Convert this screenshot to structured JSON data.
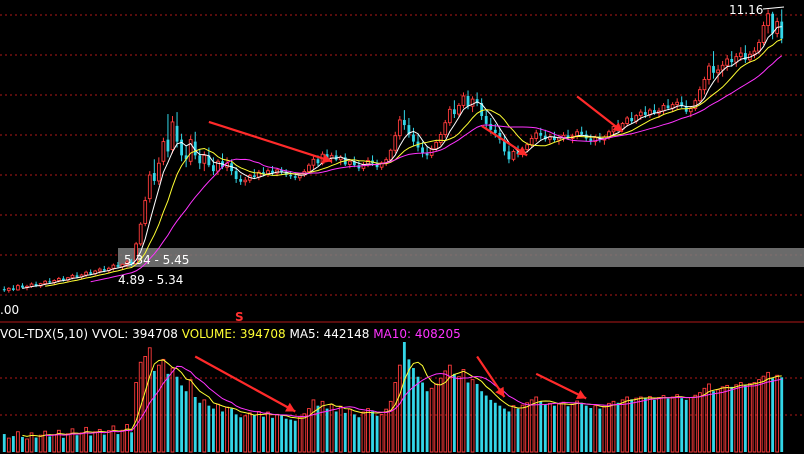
{
  "colors": {
    "background": "#000000",
    "up": "#ff3c3c",
    "down": "#33d6e8",
    "ma5": "#ffffff",
    "ma10": "#ffff33",
    "ma20": "#ff33ff",
    "vol_ma5": "#ffff33",
    "vol_ma10": "#ff33ff",
    "grid": "#b01818",
    "band": "#7d7d7d",
    "arrow": "#ff2a2a"
  },
  "chart_data": {
    "type": "candlestick",
    "price_max_label": "11.16",
    "price_min_label": ".00",
    "band_label": "5.34 - 5.45",
    "range_label": "4.89 - 5.34",
    "signal_marker": "S",
    "candles": [
      {
        "o": 4.05,
        "h": 4.12,
        "l": 3.98,
        "c": 4.02
      },
      {
        "o": 4.02,
        "h": 4.1,
        "l": 3.96,
        "c": 4.07
      },
      {
        "o": 4.07,
        "h": 4.15,
        "l": 4.0,
        "c": 4.03
      },
      {
        "o": 4.03,
        "h": 4.18,
        "l": 4.01,
        "c": 4.14
      },
      {
        "o": 4.14,
        "h": 4.2,
        "l": 4.06,
        "c": 4.09
      },
      {
        "o": 4.09,
        "h": 4.16,
        "l": 4.02,
        "c": 4.12
      },
      {
        "o": 4.12,
        "h": 4.22,
        "l": 4.08,
        "c": 4.18
      },
      {
        "o": 4.18,
        "h": 4.24,
        "l": 4.1,
        "c": 4.13
      },
      {
        "o": 4.13,
        "h": 4.21,
        "l": 4.08,
        "c": 4.19
      },
      {
        "o": 4.19,
        "h": 4.28,
        "l": 4.15,
        "c": 4.25
      },
      {
        "o": 4.25,
        "h": 4.33,
        "l": 4.18,
        "c": 4.22
      },
      {
        "o": 4.22,
        "h": 4.3,
        "l": 4.16,
        "c": 4.27
      },
      {
        "o": 4.27,
        "h": 4.36,
        "l": 4.22,
        "c": 4.32
      },
      {
        "o": 4.32,
        "h": 4.38,
        "l": 4.24,
        "c": 4.28
      },
      {
        "o": 4.28,
        "h": 4.36,
        "l": 4.22,
        "c": 4.34
      },
      {
        "o": 4.34,
        "h": 4.44,
        "l": 4.3,
        "c": 4.4
      },
      {
        "o": 4.4,
        "h": 4.48,
        "l": 4.32,
        "c": 4.36
      },
      {
        "o": 4.36,
        "h": 4.44,
        "l": 4.3,
        "c": 4.41
      },
      {
        "o": 4.41,
        "h": 4.52,
        "l": 4.36,
        "c": 4.48
      },
      {
        "o": 4.48,
        "h": 4.55,
        "l": 4.4,
        "c": 4.44
      },
      {
        "o": 4.44,
        "h": 4.54,
        "l": 4.4,
        "c": 4.51
      },
      {
        "o": 4.51,
        "h": 4.6,
        "l": 4.45,
        "c": 4.56
      },
      {
        "o": 4.56,
        "h": 4.64,
        "l": 4.48,
        "c": 4.52
      },
      {
        "o": 4.52,
        "h": 4.62,
        "l": 4.47,
        "c": 4.58
      },
      {
        "o": 4.58,
        "h": 4.7,
        "l": 4.52,
        "c": 4.66
      },
      {
        "o": 4.66,
        "h": 4.74,
        "l": 4.58,
        "c": 4.62
      },
      {
        "o": 4.62,
        "h": 4.7,
        "l": 4.55,
        "c": 4.68
      },
      {
        "o": 4.68,
        "h": 4.8,
        "l": 4.6,
        "c": 4.74
      },
      {
        "o": 4.74,
        "h": 4.82,
        "l": 4.64,
        "c": 4.69
      },
      {
        "o": 4.7,
        "h": 5.25,
        "l": 4.68,
        "c": 5.2
      },
      {
        "o": 5.2,
        "h": 5.75,
        "l": 5.15,
        "c": 5.7
      },
      {
        "o": 5.72,
        "h": 6.4,
        "l": 5.65,
        "c": 6.3
      },
      {
        "o": 6.35,
        "h": 7.05,
        "l": 6.25,
        "c": 6.95
      },
      {
        "o": 7.0,
        "h": 7.35,
        "l": 6.7,
        "c": 6.8
      },
      {
        "o": 6.8,
        "h": 7.4,
        "l": 6.7,
        "c": 7.25
      },
      {
        "o": 7.3,
        "h": 7.9,
        "l": 7.2,
        "c": 7.8
      },
      {
        "o": 7.85,
        "h": 8.5,
        "l": 7.4,
        "c": 7.55
      },
      {
        "o": 7.6,
        "h": 8.45,
        "l": 7.5,
        "c": 8.3
      },
      {
        "o": 8.2,
        "h": 8.55,
        "l": 7.65,
        "c": 7.8
      },
      {
        "o": 7.85,
        "h": 8.0,
        "l": 7.3,
        "c": 7.45
      },
      {
        "o": 7.45,
        "h": 7.7,
        "l": 7.15,
        "c": 7.35
      },
      {
        "o": 7.3,
        "h": 7.95,
        "l": 7.2,
        "c": 7.85
      },
      {
        "o": 7.8,
        "h": 8.05,
        "l": 7.35,
        "c": 7.45
      },
      {
        "o": 7.45,
        "h": 7.6,
        "l": 7.1,
        "c": 7.25
      },
      {
        "o": 7.25,
        "h": 7.55,
        "l": 7.05,
        "c": 7.45
      },
      {
        "o": 7.45,
        "h": 7.65,
        "l": 7.15,
        "c": 7.2
      },
      {
        "o": 7.2,
        "h": 7.4,
        "l": 6.95,
        "c": 7.05
      },
      {
        "o": 7.05,
        "h": 7.35,
        "l": 6.95,
        "c": 7.3
      },
      {
        "o": 7.3,
        "h": 7.5,
        "l": 7.1,
        "c": 7.15
      },
      {
        "o": 7.15,
        "h": 7.4,
        "l": 7.05,
        "c": 7.25
      },
      {
        "o": 7.25,
        "h": 7.35,
        "l": 6.95,
        "c": 7.05
      },
      {
        "o": 7.05,
        "h": 7.15,
        "l": 6.75,
        "c": 6.85
      },
      {
        "o": 6.85,
        "h": 6.95,
        "l": 6.7,
        "c": 6.78
      },
      {
        "o": 6.78,
        "h": 6.9,
        "l": 6.68,
        "c": 6.82
      },
      {
        "o": 6.82,
        "h": 6.98,
        "l": 6.75,
        "c": 6.94
      },
      {
        "o": 6.94,
        "h": 7.1,
        "l": 6.85,
        "c": 6.9
      },
      {
        "o": 6.9,
        "h": 7.08,
        "l": 6.82,
        "c": 7.02
      },
      {
        "o": 7.02,
        "h": 7.15,
        "l": 6.92,
        "c": 6.98
      },
      {
        "o": 6.98,
        "h": 7.12,
        "l": 6.9,
        "c": 7.06
      },
      {
        "o": 7.06,
        "h": 7.18,
        "l": 6.95,
        "c": 7.0
      },
      {
        "o": 7.0,
        "h": 7.12,
        "l": 6.92,
        "c": 7.08
      },
      {
        "o": 7.08,
        "h": 7.15,
        "l": 6.96,
        "c": 7.02
      },
      {
        "o": 7.02,
        "h": 7.1,
        "l": 6.9,
        "c": 6.95
      },
      {
        "o": 6.95,
        "h": 7.05,
        "l": 6.85,
        "c": 6.92
      },
      {
        "o": 6.92,
        "h": 7.02,
        "l": 6.82,
        "c": 6.88
      },
      {
        "o": 6.88,
        "h": 7.0,
        "l": 6.8,
        "c": 6.96
      },
      {
        "o": 6.96,
        "h": 7.1,
        "l": 6.9,
        "c": 7.04
      },
      {
        "o": 7.04,
        "h": 7.25,
        "l": 7.0,
        "c": 7.2
      },
      {
        "o": 7.2,
        "h": 7.42,
        "l": 7.1,
        "c": 7.35
      },
      {
        "o": 7.35,
        "h": 7.45,
        "l": 7.18,
        "c": 7.25
      },
      {
        "o": 7.25,
        "h": 7.55,
        "l": 7.2,
        "c": 7.48
      },
      {
        "o": 7.48,
        "h": 7.6,
        "l": 7.3,
        "c": 7.38
      },
      {
        "o": 7.38,
        "h": 7.52,
        "l": 7.25,
        "c": 7.45
      },
      {
        "o": 7.45,
        "h": 7.58,
        "l": 7.3,
        "c": 7.34
      },
      {
        "o": 7.34,
        "h": 7.46,
        "l": 7.2,
        "c": 7.4
      },
      {
        "o": 7.4,
        "h": 7.5,
        "l": 7.18,
        "c": 7.22
      },
      {
        "o": 7.22,
        "h": 7.36,
        "l": 7.12,
        "c": 7.3
      },
      {
        "o": 7.3,
        "h": 7.42,
        "l": 7.15,
        "c": 7.2
      },
      {
        "o": 7.2,
        "h": 7.3,
        "l": 7.05,
        "c": 7.12
      },
      {
        "o": 7.12,
        "h": 7.28,
        "l": 7.05,
        "c": 7.22
      },
      {
        "o": 7.22,
        "h": 7.4,
        "l": 7.15,
        "c": 7.32
      },
      {
        "o": 7.32,
        "h": 7.45,
        "l": 7.18,
        "c": 7.25
      },
      {
        "o": 7.25,
        "h": 7.34,
        "l": 7.08,
        "c": 7.15
      },
      {
        "o": 7.15,
        "h": 7.3,
        "l": 7.08,
        "c": 7.26
      },
      {
        "o": 7.26,
        "h": 7.4,
        "l": 7.18,
        "c": 7.34
      },
      {
        "o": 7.34,
        "h": 7.62,
        "l": 7.3,
        "c": 7.58
      },
      {
        "o": 7.58,
        "h": 8.05,
        "l": 7.5,
        "c": 7.95
      },
      {
        "o": 7.95,
        "h": 8.45,
        "l": 7.85,
        "c": 8.35
      },
      {
        "o": 8.35,
        "h": 8.6,
        "l": 8.1,
        "c": 8.22
      },
      {
        "o": 8.22,
        "h": 8.4,
        "l": 7.9,
        "c": 7.98
      },
      {
        "o": 7.98,
        "h": 8.15,
        "l": 7.7,
        "c": 7.8
      },
      {
        "o": 7.8,
        "h": 8.0,
        "l": 7.55,
        "c": 7.65
      },
      {
        "o": 7.65,
        "h": 7.8,
        "l": 7.4,
        "c": 7.5
      },
      {
        "o": 7.5,
        "h": 7.66,
        "l": 7.35,
        "c": 7.45
      },
      {
        "o": 7.45,
        "h": 7.7,
        "l": 7.38,
        "c": 7.62
      },
      {
        "o": 7.62,
        "h": 7.85,
        "l": 7.55,
        "c": 7.78
      },
      {
        "o": 7.78,
        "h": 8.05,
        "l": 7.7,
        "c": 7.98
      },
      {
        "o": 7.98,
        "h": 8.35,
        "l": 7.9,
        "c": 8.28
      },
      {
        "o": 8.28,
        "h": 8.7,
        "l": 8.2,
        "c": 8.62
      },
      {
        "o": 8.62,
        "h": 8.85,
        "l": 8.4,
        "c": 8.5
      },
      {
        "o": 8.5,
        "h": 8.78,
        "l": 8.42,
        "c": 8.72
      },
      {
        "o": 8.72,
        "h": 9.05,
        "l": 8.65,
        "c": 8.96
      },
      {
        "o": 8.96,
        "h": 9.1,
        "l": 8.62,
        "c": 8.7
      },
      {
        "o": 8.7,
        "h": 8.95,
        "l": 8.55,
        "c": 8.88
      },
      {
        "o": 8.88,
        "h": 9.05,
        "l": 8.7,
        "c": 8.78
      },
      {
        "o": 8.78,
        "h": 8.9,
        "l": 8.35,
        "c": 8.45
      },
      {
        "o": 8.45,
        "h": 8.6,
        "l": 8.15,
        "c": 8.25
      },
      {
        "o": 8.25,
        "h": 8.4,
        "l": 8.0,
        "c": 8.1
      },
      {
        "o": 8.1,
        "h": 8.25,
        "l": 7.9,
        "c": 8.02
      },
      {
        "o": 8.02,
        "h": 8.15,
        "l": 7.75,
        "c": 7.85
      },
      {
        "o": 7.85,
        "h": 7.98,
        "l": 7.45,
        "c": 7.55
      },
      {
        "o": 7.55,
        "h": 7.7,
        "l": 7.25,
        "c": 7.35
      },
      {
        "o": 7.35,
        "h": 7.6,
        "l": 7.3,
        "c": 7.55
      },
      {
        "o": 7.55,
        "h": 7.7,
        "l": 7.4,
        "c": 7.48
      },
      {
        "o": 7.48,
        "h": 7.66,
        "l": 7.4,
        "c": 7.6
      },
      {
        "o": 7.6,
        "h": 7.78,
        "l": 7.52,
        "c": 7.72
      },
      {
        "o": 7.72,
        "h": 7.95,
        "l": 7.65,
        "c": 7.88
      },
      {
        "o": 7.88,
        "h": 8.1,
        "l": 7.8,
        "c": 8.02
      },
      {
        "o": 8.02,
        "h": 8.15,
        "l": 7.85,
        "c": 7.95
      },
      {
        "o": 7.95,
        "h": 8.1,
        "l": 7.8,
        "c": 7.86
      },
      {
        "o": 7.86,
        "h": 8.0,
        "l": 7.75,
        "c": 7.92
      },
      {
        "o": 7.92,
        "h": 8.05,
        "l": 7.78,
        "c": 7.84
      },
      {
        "o": 7.84,
        "h": 7.98,
        "l": 7.72,
        "c": 7.9
      },
      {
        "o": 7.9,
        "h": 8.04,
        "l": 7.8,
        "c": 7.96
      },
      {
        "o": 7.96,
        "h": 8.1,
        "l": 7.85,
        "c": 7.88
      },
      {
        "o": 7.88,
        "h": 8.0,
        "l": 7.76,
        "c": 7.94
      },
      {
        "o": 7.94,
        "h": 8.12,
        "l": 7.86,
        "c": 8.05
      },
      {
        "o": 8.05,
        "h": 8.18,
        "l": 7.95,
        "c": 7.98
      },
      {
        "o": 7.98,
        "h": 8.08,
        "l": 7.8,
        "c": 7.88
      },
      {
        "o": 7.88,
        "h": 7.98,
        "l": 7.72,
        "c": 7.8
      },
      {
        "o": 7.8,
        "h": 7.95,
        "l": 7.7,
        "c": 7.9
      },
      {
        "o": 7.9,
        "h": 8.02,
        "l": 7.78,
        "c": 7.84
      },
      {
        "o": 7.84,
        "h": 7.96,
        "l": 7.72,
        "c": 7.92
      },
      {
        "o": 7.92,
        "h": 8.1,
        "l": 7.85,
        "c": 8.05
      },
      {
        "o": 8.05,
        "h": 8.24,
        "l": 7.98,
        "c": 8.18
      },
      {
        "o": 8.18,
        "h": 8.35,
        "l": 8.05,
        "c": 8.12
      },
      {
        "o": 8.12,
        "h": 8.3,
        "l": 8.05,
        "c": 8.26
      },
      {
        "o": 8.26,
        "h": 8.45,
        "l": 8.18,
        "c": 8.4
      },
      {
        "o": 8.4,
        "h": 8.55,
        "l": 8.25,
        "c": 8.32
      },
      {
        "o": 8.32,
        "h": 8.5,
        "l": 8.25,
        "c": 8.46
      },
      {
        "o": 8.46,
        "h": 8.62,
        "l": 8.35,
        "c": 8.55
      },
      {
        "o": 8.55,
        "h": 8.7,
        "l": 8.4,
        "c": 8.48
      },
      {
        "o": 8.48,
        "h": 8.65,
        "l": 8.4,
        "c": 8.6
      },
      {
        "o": 8.6,
        "h": 8.75,
        "l": 8.48,
        "c": 8.52
      },
      {
        "o": 8.52,
        "h": 8.66,
        "l": 8.4,
        "c": 8.58
      },
      {
        "o": 8.58,
        "h": 8.78,
        "l": 8.5,
        "c": 8.72
      },
      {
        "o": 8.72,
        "h": 8.88,
        "l": 8.6,
        "c": 8.65
      },
      {
        "o": 8.65,
        "h": 8.8,
        "l": 8.55,
        "c": 8.74
      },
      {
        "o": 8.74,
        "h": 8.9,
        "l": 8.62,
        "c": 8.8
      },
      {
        "o": 8.8,
        "h": 8.95,
        "l": 8.66,
        "c": 8.7
      },
      {
        "o": 8.7,
        "h": 8.85,
        "l": 8.5,
        "c": 8.56
      },
      {
        "o": 8.56,
        "h": 8.7,
        "l": 8.42,
        "c": 8.64
      },
      {
        "o": 8.64,
        "h": 8.9,
        "l": 8.58,
        "c": 8.84
      },
      {
        "o": 8.84,
        "h": 9.2,
        "l": 8.78,
        "c": 9.12
      },
      {
        "o": 9.12,
        "h": 9.45,
        "l": 9.0,
        "c": 9.38
      },
      {
        "o": 9.38,
        "h": 9.8,
        "l": 9.25,
        "c": 9.72
      },
      {
        "o": 9.72,
        "h": 10.1,
        "l": 9.4,
        "c": 9.55
      },
      {
        "o": 9.55,
        "h": 9.75,
        "l": 9.3,
        "c": 9.62
      },
      {
        "o": 9.62,
        "h": 9.85,
        "l": 9.45,
        "c": 9.74
      },
      {
        "o": 9.74,
        "h": 10.0,
        "l": 9.6,
        "c": 9.9
      },
      {
        "o": 9.9,
        "h": 10.1,
        "l": 9.7,
        "c": 9.82
      },
      {
        "o": 9.82,
        "h": 10.05,
        "l": 9.7,
        "c": 9.96
      },
      {
        "o": 9.96,
        "h": 10.2,
        "l": 9.85,
        "c": 10.05
      },
      {
        "o": 10.05,
        "h": 10.25,
        "l": 9.8,
        "c": 9.88
      },
      {
        "o": 9.88,
        "h": 10.1,
        "l": 9.8,
        "c": 10.02
      },
      {
        "o": 10.02,
        "h": 10.2,
        "l": 9.92,
        "c": 10.1
      },
      {
        "o": 10.1,
        "h": 10.4,
        "l": 10.02,
        "c": 10.32
      },
      {
        "o": 10.32,
        "h": 10.85,
        "l": 10.25,
        "c": 10.75
      },
      {
        "o": 10.75,
        "h": 11.16,
        "l": 10.55,
        "c": 11.05
      },
      {
        "o": 11.05,
        "h": 11.1,
        "l": 10.4,
        "c": 10.55
      },
      {
        "o": 10.55,
        "h": 10.95,
        "l": 10.45,
        "c": 10.85
      },
      {
        "o": 10.85,
        "h": 11.16,
        "l": 10.3,
        "c": 10.42
      }
    ],
    "volume": [
      62,
      48,
      55,
      70,
      52,
      45,
      66,
      50,
      58,
      72,
      54,
      60,
      75,
      49,
      63,
      80,
      58,
      66,
      85,
      57,
      70,
      78,
      60,
      74,
      90,
      62,
      75,
      95,
      68,
      240,
      310,
      330,
      360,
      280,
      300,
      320,
      270,
      290,
      260,
      230,
      210,
      250,
      190,
      170,
      180,
      160,
      150,
      165,
      140,
      155,
      150,
      130,
      120,
      125,
      135,
      128,
      140,
      122,
      138,
      118,
      130,
      126,
      115,
      112,
      108,
      120,
      132,
      150,
      180,
      160,
      175,
      150,
      165,
      140,
      158,
      135,
      148,
      130,
      120,
      138,
      150,
      140,
      125,
      130,
      148,
      175,
      240,
      300,
      380,
      320,
      290,
      260,
      240,
      210,
      220,
      235,
      255,
      280,
      300,
      270,
      260,
      285,
      240,
      250,
      235,
      210,
      195,
      180,
      170,
      160,
      150,
      140,
      160,
      150,
      162,
      170,
      180,
      190,
      175,
      165,
      168,
      160,
      166,
      172,
      158,
      165,
      176,
      170,
      160,
      152,
      160,
      150,
      158,
      168,
      175,
      170,
      180,
      190,
      182,
      186,
      190,
      185,
      192,
      180,
      188,
      195,
      185,
      190,
      198,
      186,
      180,
      188,
      196,
      205,
      220,
      235,
      210,
      215,
      225,
      230,
      225,
      232,
      240,
      230,
      236,
      240,
      250,
      262,
      275,
      255,
      265,
      258
    ],
    "vol_legend": {
      "title": "VOL-TDX(5,10)",
      "vvol_label": "VVOL:",
      "vvol_value": "394708",
      "volume_label": "VOLUME:",
      "volume_value": "394708",
      "ma5_label": "MA5:",
      "ma5_value": "442148",
      "ma10_label": "MA10:",
      "ma10_value": "408205"
    },
    "annotations": [
      {
        "type": "arrow",
        "panel": "price",
        "from_index": 45,
        "to_index": 72,
        "from_price": 8.3,
        "to_price": 7.3
      },
      {
        "type": "arrow",
        "panel": "price",
        "from_index": 105,
        "to_index": 115,
        "from_price": 8.2,
        "to_price": 7.45
      },
      {
        "type": "arrow",
        "panel": "price",
        "from_index": 126,
        "to_index": 136,
        "from_price": 8.95,
        "to_price": 8.05
      },
      {
        "type": "arrow",
        "panel": "volume",
        "from_index": 42,
        "to_index": 64,
        "from_volume": 330,
        "to_volume": 140
      },
      {
        "type": "arrow",
        "panel": "volume",
        "from_index": 104,
        "to_index": 110,
        "from_volume": 330,
        "to_volume": 190
      },
      {
        "type": "arrow",
        "panel": "volume",
        "from_index": 117,
        "to_index": 128,
        "from_volume": 270,
        "to_volume": 185
      }
    ]
  }
}
